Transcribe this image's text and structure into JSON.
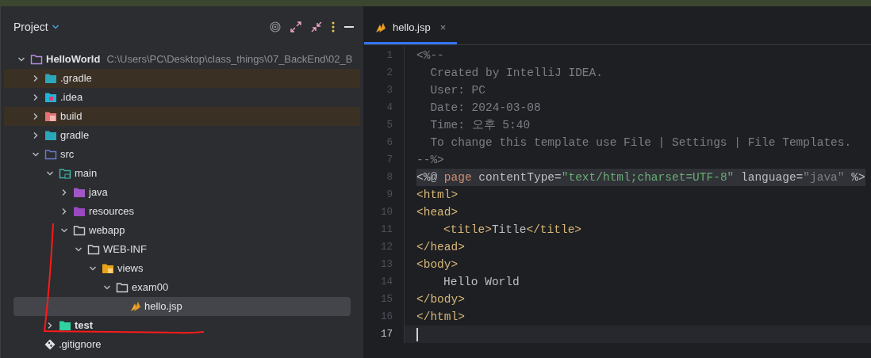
{
  "project_panel": {
    "title": "Project",
    "tree": [
      {
        "name": "HelloWorld",
        "path": "C:\\Users\\PC\\Desktop\\class_things\\07_BackEnd\\02_B",
        "kind": "module",
        "bold": true,
        "expanded": true,
        "excluded": false,
        "selected": false,
        "children": [
          {
            "name": ".gradle",
            "kind": "gradle",
            "expanded": false,
            "excluded": true,
            "selected": false
          },
          {
            "name": ".idea",
            "kind": "idea",
            "expanded": false,
            "excluded": false,
            "selected": false
          },
          {
            "name": "build",
            "kind": "build",
            "expanded": false,
            "excluded": true,
            "selected": false
          },
          {
            "name": "gradle",
            "kind": "gradle",
            "expanded": false,
            "excluded": false,
            "selected": false
          },
          {
            "name": "src",
            "kind": "source",
            "expanded": true,
            "excluded": false,
            "selected": false,
            "children": [
              {
                "name": "main",
                "kind": "main",
                "expanded": true,
                "excluded": false,
                "selected": false,
                "children": [
                  {
                    "name": "java",
                    "kind": "java",
                    "expanded": false,
                    "excluded": false,
                    "selected": false
                  },
                  {
                    "name": "resources",
                    "kind": "resources",
                    "expanded": false,
                    "excluded": false,
                    "selected": false
                  },
                  {
                    "name": "webapp",
                    "kind": "folder",
                    "expanded": true,
                    "excluded": false,
                    "selected": false,
                    "children": [
                      {
                        "name": "WEB-INF",
                        "kind": "folder",
                        "expanded": true,
                        "excluded": false,
                        "selected": false,
                        "children": [
                          {
                            "name": "views",
                            "kind": "views",
                            "expanded": true,
                            "excluded": false,
                            "selected": false,
                            "children": [
                              {
                                "name": "exam00",
                                "kind": "folder",
                                "expanded": true,
                                "excluded": false,
                                "selected": false,
                                "children": [
                                  {
                                    "name": "hello.jsp",
                                    "kind": "jsp",
                                    "excluded": false,
                                    "selected": true
                                  }
                                ]
                              }
                            ]
                          }
                        ]
                      }
                    ]
                  }
                ]
              },
              {
                "name": "test",
                "kind": "test",
                "bold": true,
                "expanded": false,
                "excluded": false,
                "selected": false
              }
            ]
          },
          {
            "name": ".gitignore",
            "kind": "git",
            "excluded": false,
            "selected": false
          }
        ]
      }
    ]
  },
  "editor": {
    "tabs": [
      {
        "label": "hello.jsp",
        "close": "×",
        "selected": true
      }
    ],
    "lines": [
      {
        "number": "1",
        "current": false,
        "highlighted": false,
        "tokens": [
          {
            "kind": "comment",
            "text": "<%--"
          }
        ]
      },
      {
        "number": "2",
        "current": false,
        "highlighted": false,
        "tokens": [
          {
            "kind": "comment",
            "text": "  Created by IntelliJ IDEA."
          }
        ]
      },
      {
        "number": "3",
        "current": false,
        "highlighted": false,
        "tokens": [
          {
            "kind": "comment",
            "text": "  User: PC"
          }
        ]
      },
      {
        "number": "4",
        "current": false,
        "highlighted": false,
        "tokens": [
          {
            "kind": "comment",
            "text": "  Date: 2024-03-08"
          }
        ]
      },
      {
        "number": "5",
        "current": false,
        "highlighted": false,
        "tokens": [
          {
            "kind": "comment",
            "text": "  Time: 오후 5:40"
          }
        ]
      },
      {
        "number": "6",
        "current": false,
        "highlighted": false,
        "tokens": [
          {
            "kind": "comment",
            "text": "  To change this template use File | Settings | File Templates."
          }
        ]
      },
      {
        "number": "7",
        "current": false,
        "highlighted": false,
        "tokens": [
          {
            "kind": "comment",
            "text": "--%>"
          }
        ]
      },
      {
        "number": "8",
        "current": false,
        "highlighted": true,
        "tokens": [
          {
            "kind": "plain",
            "text": "<%@ "
          },
          {
            "kind": "keyword",
            "text": "page"
          },
          {
            "kind": "plain",
            "text": " contentType="
          },
          {
            "kind": "string",
            "text": "\"text/html;charset=UTF-8\""
          },
          {
            "kind": "plain",
            "text": " language="
          },
          {
            "kind": "muted",
            "text": "\"java\""
          },
          {
            "kind": "plain",
            "text": " %>"
          }
        ]
      },
      {
        "number": "9",
        "current": false,
        "highlighted": false,
        "tokens": [
          {
            "kind": "tag",
            "text": "<html>"
          }
        ]
      },
      {
        "number": "10",
        "current": false,
        "highlighted": false,
        "tokens": [
          {
            "kind": "tag",
            "text": "<head>"
          }
        ]
      },
      {
        "number": "11",
        "current": false,
        "highlighted": false,
        "indented": true,
        "tokens": [
          {
            "kind": "tag",
            "text": "<title>"
          },
          {
            "kind": "plain",
            "text": "Title"
          },
          {
            "kind": "tag",
            "text": "</title>"
          }
        ]
      },
      {
        "number": "12",
        "current": false,
        "highlighted": false,
        "tokens": [
          {
            "kind": "tag",
            "text": "</head>"
          }
        ]
      },
      {
        "number": "13",
        "current": false,
        "highlighted": false,
        "tokens": [
          {
            "kind": "tag",
            "text": "<body>"
          }
        ]
      },
      {
        "number": "14",
        "current": false,
        "highlighted": false,
        "indented": true,
        "tokens": [
          {
            "kind": "plain",
            "text": "Hello World"
          }
        ]
      },
      {
        "number": "15",
        "current": false,
        "highlighted": false,
        "tokens": [
          {
            "kind": "tag",
            "text": "</body>"
          }
        ]
      },
      {
        "number": "16",
        "current": false,
        "highlighted": false,
        "tokens": [
          {
            "kind": "tag",
            "text": "</html>"
          }
        ]
      },
      {
        "number": "17",
        "current": true,
        "highlighted": false
      }
    ]
  }
}
